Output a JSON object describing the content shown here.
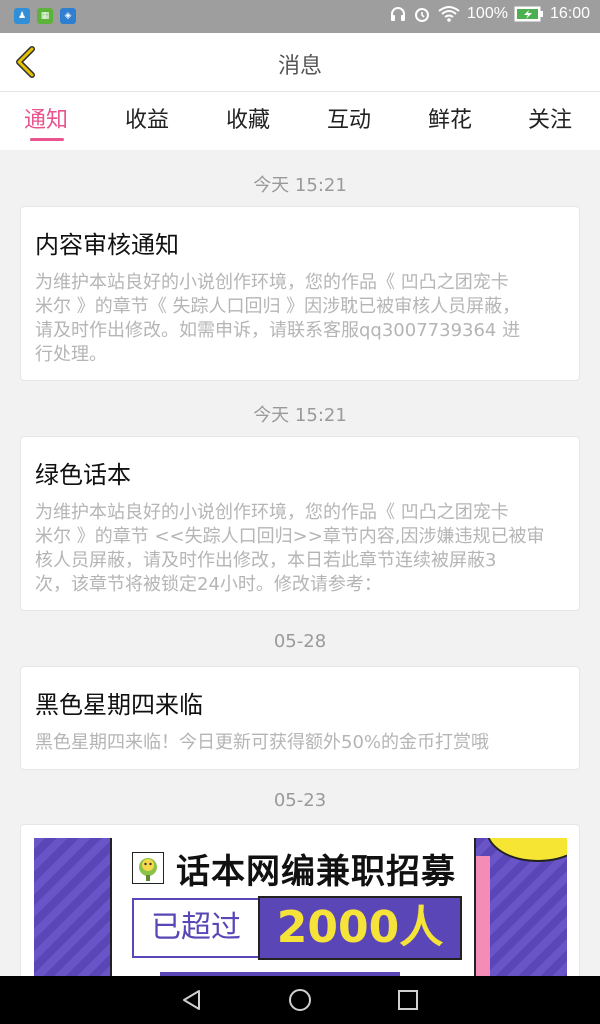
{
  "status_bar": {
    "app_icons": [
      "qq-assistant-icon",
      "calendar-app-icon",
      "shield-app-icon"
    ],
    "battery_percent": "100%",
    "time": "16:00"
  },
  "header": {
    "title": "消息"
  },
  "tabs": [
    {
      "label": "通知",
      "active": true
    },
    {
      "label": "收益",
      "active": false
    },
    {
      "label": "收藏",
      "active": false
    },
    {
      "label": "互动",
      "active": false
    },
    {
      "label": "鲜花",
      "active": false
    },
    {
      "label": "关注",
      "active": false
    }
  ],
  "messages": [
    {
      "date": "今天 15:21",
      "title": "内容审核通知",
      "body_lines": [
        "为维护本站良好的小说创作环境，您的作品《 凹凸之团宠卡",
        "米尔 》的章节《 失踪人口回归 》因涉耽已被审核人员屏蔽，",
        "请及时作出修改。如需申诉，请联系客服qq3007739364 进",
        "行处理。"
      ]
    },
    {
      "date": "今天 15:21",
      "title": "绿色话本",
      "body_lines": [
        "为维护本站良好的小说创作环境，您的作品《 凹凸之团宠卡",
        "米尔 》的章节 <<失踪人口回归>>章节内容,因涉嫌违规已被审",
        "核人员屏蔽，请及时作出修改，本日若此章节连续被屏蔽3",
        "次，该章节将被锁定24小时。修改请参考："
      ]
    },
    {
      "date": "05-28",
      "title": "黑色星期四来临",
      "body_lines": [
        "黑色星期四来临！今日更新可获得额外50%的金币打赏哦"
      ]
    }
  ],
  "banner_section": {
    "date": "05-23",
    "title": "话本网编兼职招募",
    "label": "已超过",
    "count": "2000人"
  },
  "colors": {
    "accent": "#e8548e",
    "banner_purple": "#5a46b6",
    "banner_yellow": "#f5e33a"
  }
}
